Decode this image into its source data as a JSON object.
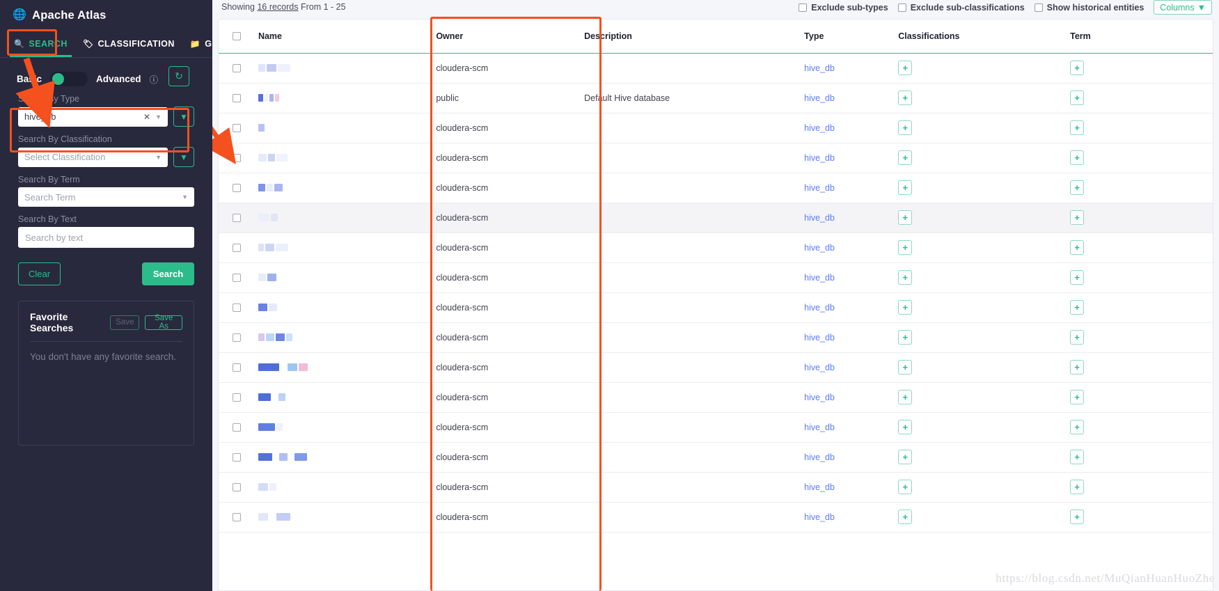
{
  "brand": {
    "title": "Apache Atlas",
    "icon": "globe-icon"
  },
  "tabs": [
    {
      "label": "SEARCH",
      "icon": "search-icon",
      "active": true
    },
    {
      "label": "CLASSIFICATION",
      "icon": "tag-icon",
      "active": false
    },
    {
      "label": "GLOSSARY",
      "icon": "folder-icon",
      "active": false
    }
  ],
  "search_panel": {
    "mode_basic": "Basic",
    "mode_advanced": "Advanced",
    "help_icon": "question-circle-icon",
    "refresh_icon": "refresh-icon",
    "filter_icon": "filter-icon",
    "fields": {
      "type": {
        "label": "Search By Type",
        "value": "hive_db",
        "clear_icon": "clear-x-icon",
        "caret_icon": "caret-down-icon"
      },
      "classification": {
        "label": "Search By Classification",
        "placeholder": "Select Classification",
        "caret_icon": "caret-down-icon"
      },
      "term": {
        "label": "Search By Term",
        "placeholder": "Search Term",
        "caret_icon": "caret-down-icon"
      },
      "text": {
        "label": "Search By Text",
        "placeholder": "Search by text"
      }
    },
    "clear_label": "Clear",
    "search_label": "Search"
  },
  "favorites": {
    "title": "Favorite Searches",
    "save_label": "Save",
    "save_as_label": "Save As",
    "empty_text": "You don't have any favorite search."
  },
  "results_toolbar": {
    "showing_prefix": "Showing",
    "showing_count": "16 records",
    "showing_range": "From 1 - 25",
    "checkboxes": [
      {
        "label": "Exclude sub-types",
        "checked": false
      },
      {
        "label": "Exclude sub-classifications",
        "checked": false
      },
      {
        "label": "Show historical entities",
        "checked": false
      }
    ],
    "columns_label": "Columns",
    "columns_caret": "caret-down-icon"
  },
  "table": {
    "columns": [
      "",
      "Name",
      "Owner",
      "Description",
      "Type",
      "Classifications",
      "Term"
    ],
    "add_icon": "plus-icon",
    "rows": [
      {
        "name_redacted": true,
        "owner": "cloudera-scm",
        "description": "",
        "type": "hive_db",
        "hover": false
      },
      {
        "name_redacted": true,
        "owner": "public",
        "description": "Default Hive database",
        "type": "hive_db",
        "hover": false
      },
      {
        "name_redacted": true,
        "owner": "cloudera-scm",
        "description": "",
        "type": "hive_db",
        "hover": false
      },
      {
        "name_redacted": true,
        "owner": "cloudera-scm",
        "description": "",
        "type": "hive_db",
        "hover": false
      },
      {
        "name_redacted": true,
        "owner": "cloudera-scm",
        "description": "",
        "type": "hive_db",
        "hover": false
      },
      {
        "name_redacted": true,
        "owner": "cloudera-scm",
        "description": "",
        "type": "hive_db",
        "hover": true
      },
      {
        "name_redacted": true,
        "owner": "cloudera-scm",
        "description": "",
        "type": "hive_db",
        "hover": false
      },
      {
        "name_redacted": true,
        "owner": "cloudera-scm",
        "description": "",
        "type": "hive_db",
        "hover": false
      },
      {
        "name_redacted": true,
        "owner": "cloudera-scm",
        "description": "",
        "type": "hive_db",
        "hover": false
      },
      {
        "name_redacted": true,
        "owner": "cloudera-scm",
        "description": "",
        "type": "hive_db",
        "hover": false
      },
      {
        "name_redacted": true,
        "owner": "cloudera-scm",
        "description": "",
        "type": "hive_db",
        "hover": false
      },
      {
        "name_redacted": true,
        "owner": "cloudera-scm",
        "description": "",
        "type": "hive_db",
        "hover": false
      },
      {
        "name_redacted": true,
        "owner": "cloudera-scm",
        "description": "",
        "type": "hive_db",
        "hover": false
      },
      {
        "name_redacted": true,
        "owner": "cloudera-scm",
        "description": "",
        "type": "hive_db",
        "hover": false
      },
      {
        "name_redacted": true,
        "owner": "cloudera-scm",
        "description": "",
        "type": "hive_db",
        "hover": false
      },
      {
        "name_redacted": true,
        "owner": "cloudera-scm",
        "description": "",
        "type": "hive_db",
        "hover": false
      }
    ]
  },
  "watermark": "https://blog.csdn.net/MuQianHuanHuoZhe",
  "colors": {
    "sidebar_bg": "#28293d",
    "accent_green": "#2bbc8a",
    "annotation_orange": "#f4511e",
    "type_link_blue": "#5c7cfa",
    "main_bg": "#f5f6fa"
  }
}
